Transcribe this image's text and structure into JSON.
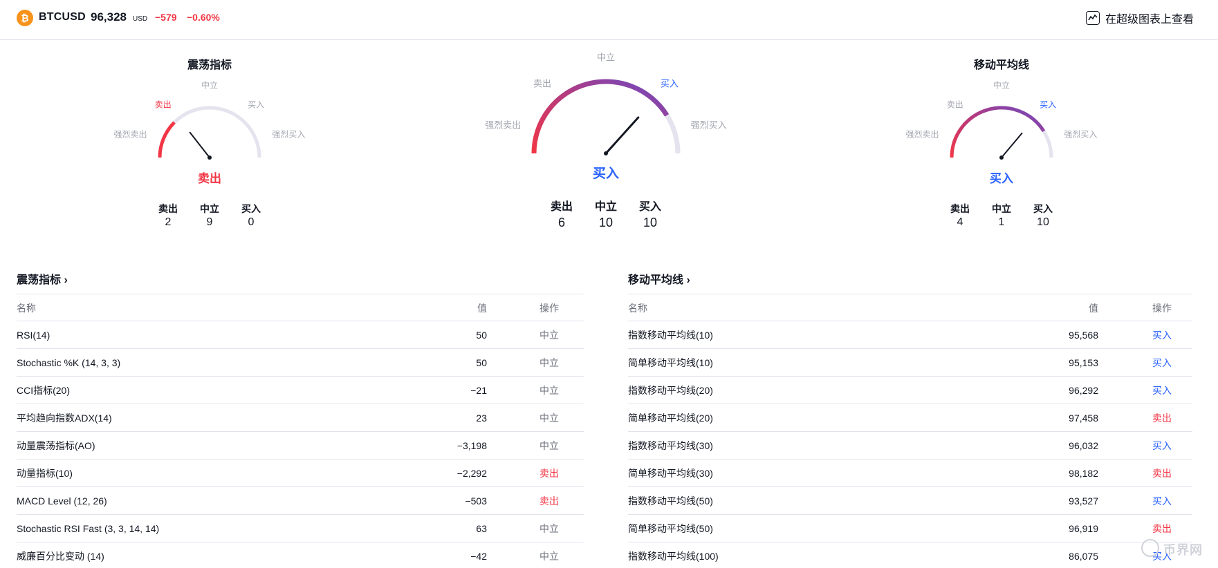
{
  "header": {
    "symbol": "BTCUSD",
    "price": "96,328",
    "currency": "USD",
    "change": "−579",
    "change_percent": "−0.60%",
    "btc_icon_glyph": "₿",
    "chart_link_label": "在超级图表上查看",
    "chart_link_icon": "chart-line-icon"
  },
  "colors": {
    "sell": "#f23645",
    "buy": "#2962ff",
    "neutral": "#a3a6af",
    "brand_orange": "#f7931a"
  },
  "gauge_scale_labels": {
    "strong_sell": "强烈卖出",
    "sell": "卖出",
    "neutral": "中立",
    "buy": "买入",
    "strong_buy": "强烈买入"
  },
  "gauges": {
    "oscillators": {
      "title": "震荡指标",
      "result": "卖出",
      "sell_label": "卖出",
      "neutral_label": "中立",
      "buy_label": "买入",
      "sell_count": "2",
      "neutral_count": "9",
      "buy_count": "0"
    },
    "summary": {
      "result": "买入",
      "sell_label": "卖出",
      "neutral_label": "中立",
      "buy_label": "买入",
      "sell_count": "6",
      "neutral_count": "10",
      "buy_count": "10"
    },
    "moving_averages": {
      "title": "移动平均线",
      "result": "买入",
      "sell_label": "卖出",
      "neutral_label": "中立",
      "buy_label": "买入",
      "sell_count": "4",
      "neutral_count": "1",
      "buy_count": "10"
    }
  },
  "oscillators_table": {
    "title": "震荡指标 ›",
    "columns": {
      "name": "名称",
      "value": "值",
      "action": "操作"
    },
    "rows": [
      {
        "name": "RSI(14)",
        "value": "50",
        "action": "中立"
      },
      {
        "name": "Stochastic %K (14, 3, 3)",
        "value": "50",
        "action": "中立"
      },
      {
        "name": "CCI指标(20)",
        "value": "−21",
        "action": "中立"
      },
      {
        "name": "平均趋向指数ADX(14)",
        "value": "23",
        "action": "中立"
      },
      {
        "name": "动量震荡指标(AO)",
        "value": "−3,198",
        "action": "中立"
      },
      {
        "name": "动量指标(10)",
        "value": "−2,292",
        "action": "卖出"
      },
      {
        "name": "MACD Level (12, 26)",
        "value": "−503",
        "action": "卖出"
      },
      {
        "name": "Stochastic RSI Fast (3, 3, 14, 14)",
        "value": "63",
        "action": "中立"
      },
      {
        "name": "威廉百分比变动 (14)",
        "value": "−42",
        "action": "中立"
      }
    ]
  },
  "ma_table": {
    "title": "移动平均线 ›",
    "columns": {
      "name": "名称",
      "value": "值",
      "action": "操作"
    },
    "rows": [
      {
        "name": "指数移动平均线(10)",
        "value": "95,568",
        "action": "买入"
      },
      {
        "name": "简单移动平均线(10)",
        "value": "95,153",
        "action": "买入"
      },
      {
        "name": "指数移动平均线(20)",
        "value": "96,292",
        "action": "买入"
      },
      {
        "name": "简单移动平均线(20)",
        "value": "97,458",
        "action": "卖出"
      },
      {
        "name": "指数移动平均线(30)",
        "value": "96,032",
        "action": "买入"
      },
      {
        "name": "简单移动平均线(30)",
        "value": "98,182",
        "action": "卖出"
      },
      {
        "name": "指数移动平均线(50)",
        "value": "93,527",
        "action": "买入"
      },
      {
        "name": "简单移动平均线(50)",
        "value": "96,919",
        "action": "卖出"
      },
      {
        "name": "指数移动平均线(100)",
        "value": "86,075",
        "action": "买入"
      }
    ]
  },
  "watermark": "币界网"
}
